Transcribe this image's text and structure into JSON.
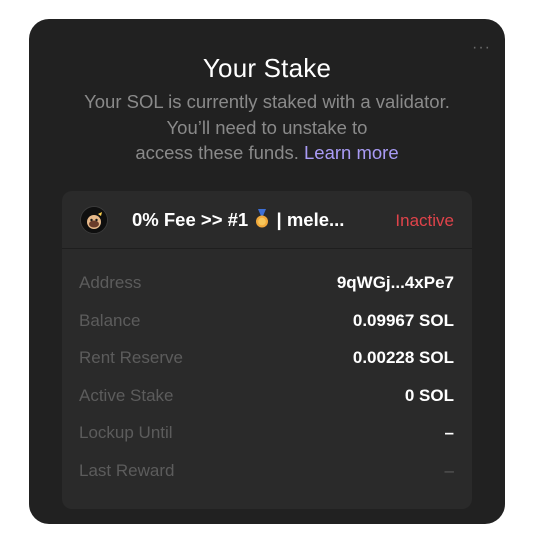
{
  "stake": {
    "title": "Your Stake",
    "more_label": "···",
    "description": "Your SOL is currently staked with a validator. You’ll need to unstake to access these funds.",
    "description_line1": "Your SOL is currently staked with a validator.",
    "description_line2": "You’ll need to unstake to",
    "description_line3": "access these funds.",
    "learn_more": "Learn more"
  },
  "validator": {
    "name_prefix": "0% Fee >> #1",
    "name_suffix": "| mele...",
    "avatar_icon": "validator-avatar-icon",
    "medal_icon": "medal-icon",
    "status": "Inactive"
  },
  "details": [
    {
      "label": "Address",
      "value": "9qWGj...4xPe7"
    },
    {
      "label": "Balance",
      "value": "0.09967 SOL"
    },
    {
      "label": "Rent Reserve",
      "value": "0.00228 SOL"
    },
    {
      "label": "Active Stake",
      "value": "0 SOL"
    },
    {
      "label": "Lockup Until",
      "value": "–"
    },
    {
      "label": "Last Reward",
      "value": "–"
    }
  ],
  "colors": {
    "card_bg": "#212121",
    "panel_bg": "#2a2a2a",
    "link": "#a99bf5",
    "status_inactive": "#e0434a"
  }
}
